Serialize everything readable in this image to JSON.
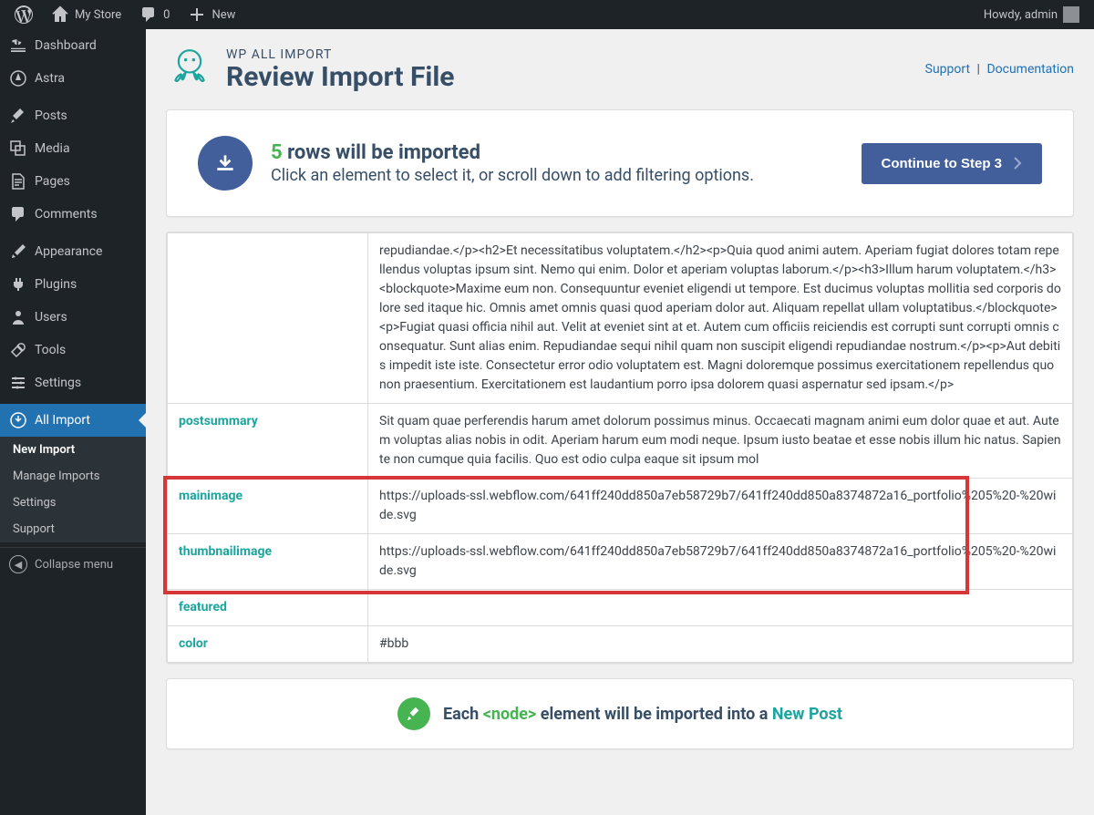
{
  "topbar": {
    "site_name": "My Store",
    "comments_count": "0",
    "new_label": "New",
    "howdy": "Howdy, admin"
  },
  "sidebar": {
    "items": [
      {
        "id": "dashboard",
        "label": "Dashboard"
      },
      {
        "id": "astra",
        "label": "Astra"
      },
      {
        "id": "posts",
        "label": "Posts"
      },
      {
        "id": "media",
        "label": "Media"
      },
      {
        "id": "pages",
        "label": "Pages"
      },
      {
        "id": "comments",
        "label": "Comments"
      },
      {
        "id": "appearance",
        "label": "Appearance"
      },
      {
        "id": "plugins",
        "label": "Plugins"
      },
      {
        "id": "users",
        "label": "Users"
      },
      {
        "id": "tools",
        "label": "Tools"
      },
      {
        "id": "settings",
        "label": "Settings"
      },
      {
        "id": "all-import",
        "label": "All Import"
      }
    ],
    "submenu": [
      {
        "label": "New Import",
        "current": true
      },
      {
        "label": "Manage Imports",
        "current": false
      },
      {
        "label": "Settings",
        "current": false
      },
      {
        "label": "Support",
        "current": false
      }
    ],
    "collapse": "Collapse menu"
  },
  "header": {
    "brand": "WP ALL IMPORT",
    "title": "Review Import File",
    "support": "Support",
    "documentation": "Documentation"
  },
  "summary": {
    "count": "5",
    "line1_suffix": " rows will be imported",
    "line2": "Click an element to select it, or scroll down to add filtering options.",
    "button": "Continue to Step 3"
  },
  "table": {
    "rows": [
      {
        "key": "",
        "val": "repudiandae.</p><h2>Et necessitatibus voluptatem.</h2><p>Quia quod animi autem. Aperiam fugiat dolores totam repellendus voluptas ipsum sint. Nemo qui enim. Dolor et aperiam voluptas laborum.</p><h3>Illum harum voluptatem.</h3><blockquote>Maxime eum non. Consequuntur eveniet eligendi ut tempore. Est ducimus voluptas mollitia sed corporis dolore sed itaque hic. Omnis amet omnis quasi quod aperiam dolor aut. Aliquam repellat ullam voluptatibus.</blockquote><p>Fugiat quasi officia nihil aut. Velit at eveniet sint at et. Autem cum officiis reiciendis est corrupti sunt corrupti omnis consequatur. Sunt alias enim. Repudiandae sequi nihil quam non suscipit eligendi repudiandae nostrum.</p><p>Aut debitis impedit iste iste. Consectetur error odio voluptatem est. Magni doloremque possimus exercitationem repellendus quo non praesentium. Exercitationem est laudantium porro ipsa dolorem quasi aspernatur sed ipsam.</p>"
      },
      {
        "key": "postsummary",
        "val": "Sit quam quae perferendis harum amet dolorum possimus minus. Occaecati magnam animi eum dolor quae et aut. Autem voluptas alias nobis in odit. Aperiam harum eum modi neque. Ipsum iusto beatae et esse nobis illum hic natus. Sapiente non cumque quia facilis. Quo est odio culpa eaque sit ipsum mol"
      },
      {
        "key": "mainimage",
        "val": "https://uploads-ssl.webflow.com/641ff240dd850a7eb58729b7/641ff240dd850a8374872a16_portfolio%205%20-%20wide.svg",
        "highlight": true
      },
      {
        "key": "thumbnailimage",
        "val": "https://uploads-ssl.webflow.com/641ff240dd850a7eb58729b7/641ff240dd850a8374872a16_portfolio%205%20-%20wide.svg",
        "highlight": true
      },
      {
        "key": "featured",
        "val": ""
      },
      {
        "key": "color",
        "val": "#bbb"
      }
    ]
  },
  "footer": {
    "prefix": "Each ",
    "node": "<node>",
    "mid": " element will be imported into a ",
    "newpost": "New Post"
  }
}
